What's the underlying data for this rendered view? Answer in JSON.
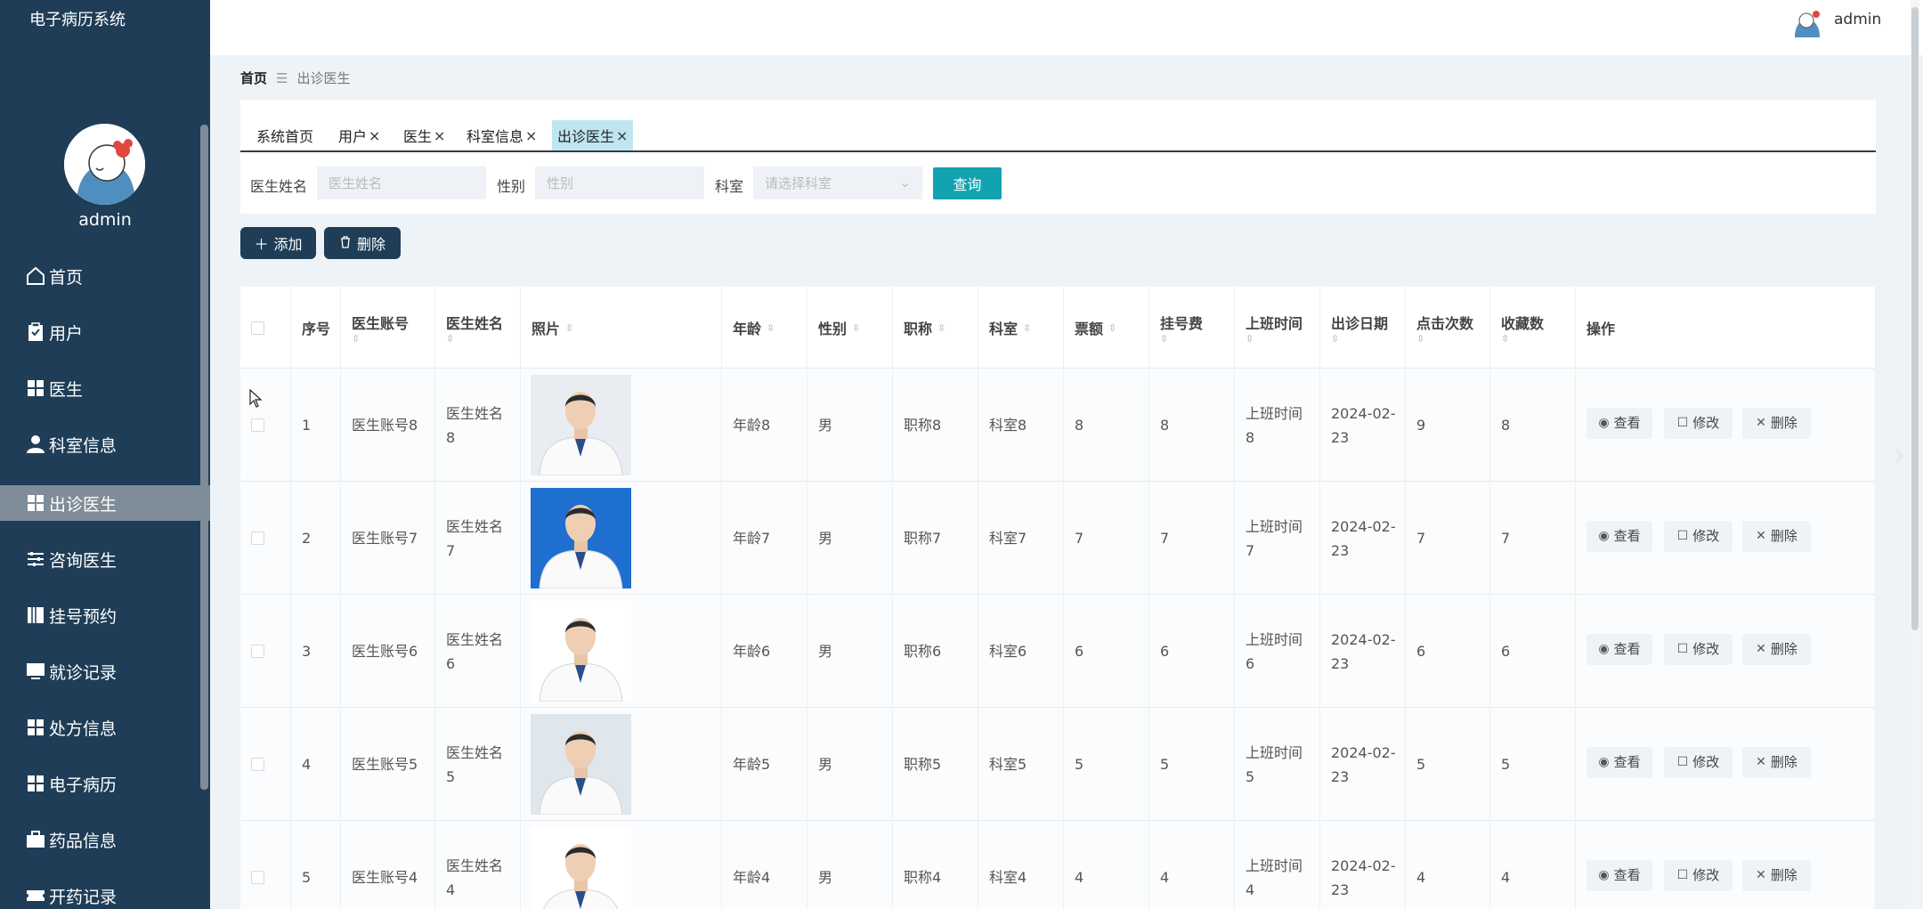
{
  "app": {
    "title": "电子病历系统",
    "user": "admin"
  },
  "sidebar": {
    "username": "admin",
    "items": [
      {
        "label": "首页",
        "icon": "home-icon"
      },
      {
        "label": "用户",
        "icon": "clipboard-icon"
      },
      {
        "label": "医生",
        "icon": "grid-icon"
      },
      {
        "label": "科室信息",
        "icon": "person-icon"
      },
      {
        "label": "出诊医生",
        "icon": "grid-icon",
        "active": true
      },
      {
        "label": "咨询医生",
        "icon": "sliders-icon"
      },
      {
        "label": "挂号预约",
        "icon": "book-icon"
      },
      {
        "label": "就诊记录",
        "icon": "monitor-icon"
      },
      {
        "label": "处方信息",
        "icon": "grid-icon"
      },
      {
        "label": "电子病历",
        "icon": "grid-icon"
      },
      {
        "label": "药品信息",
        "icon": "briefcase-icon"
      },
      {
        "label": "开药记录",
        "icon": "ticket-icon"
      }
    ]
  },
  "breadcrumb": {
    "home": "首页",
    "sep": "☰",
    "current": "出诊医生"
  },
  "tabs": [
    {
      "label": "系统首页",
      "closable": false
    },
    {
      "label": "用户",
      "closable": true
    },
    {
      "label": "医生",
      "closable": true
    },
    {
      "label": "科室信息",
      "closable": true
    },
    {
      "label": "出诊医生",
      "closable": true,
      "active": true
    }
  ],
  "tab_close_glyph": "×",
  "search": {
    "name_label": "医生姓名",
    "name_placeholder": "医生姓名",
    "gender_label": "性别",
    "gender_placeholder": "性别",
    "dept_label": "科室",
    "dept_placeholder": "请选择科室",
    "query_button": "查询"
  },
  "actions": {
    "add": "添加",
    "delete": "删除"
  },
  "table": {
    "columns": {
      "index": "序号",
      "account": "医生账号",
      "name": "医生姓名",
      "photo": "照片",
      "age": "年龄",
      "gender": "性别",
      "title": "职称",
      "dept": "科室",
      "ticket": "票额",
      "fee": "挂号费",
      "worktime": "上班时间",
      "date": "出诊日期",
      "clicks": "点击次数",
      "favs": "收藏数",
      "ops": "操作"
    },
    "sort_glyph": "⇳",
    "op_labels": {
      "view": "查看",
      "edit": "修改",
      "delete": "删除"
    },
    "rows": [
      {
        "index": "1",
        "account": "医生账号8",
        "name1": "医生姓名",
        "name2": "8",
        "age": "年龄8",
        "gender": "男",
        "title": "职称8",
        "dept": "科室8",
        "ticket": "8",
        "fee": "8",
        "work1": "上班时间",
        "work2": "8",
        "date1": "2024-02-",
        "date2": "23",
        "clicks": "9",
        "favs": "8"
      },
      {
        "index": "2",
        "account": "医生账号7",
        "name1": "医生姓名",
        "name2": "7",
        "age": "年龄7",
        "gender": "男",
        "title": "职称7",
        "dept": "科室7",
        "ticket": "7",
        "fee": "7",
        "work1": "上班时间",
        "work2": "7",
        "date1": "2024-02-",
        "date2": "23",
        "clicks": "7",
        "favs": "7"
      },
      {
        "index": "3",
        "account": "医生账号6",
        "name1": "医生姓名",
        "name2": "6",
        "age": "年龄6",
        "gender": "男",
        "title": "职称6",
        "dept": "科室6",
        "ticket": "6",
        "fee": "6",
        "work1": "上班时间",
        "work2": "6",
        "date1": "2024-02-",
        "date2": "23",
        "clicks": "6",
        "favs": "6"
      },
      {
        "index": "4",
        "account": "医生账号5",
        "name1": "医生姓名",
        "name2": "5",
        "age": "年龄5",
        "gender": "男",
        "title": "职称5",
        "dept": "科室5",
        "ticket": "5",
        "fee": "5",
        "work1": "上班时间",
        "work2": "5",
        "date1": "2024-02-",
        "date2": "23",
        "clicks": "5",
        "favs": "5"
      },
      {
        "index": "5",
        "account": "医生账号4",
        "name1": "医生姓名",
        "name2": "4",
        "age": "年龄4",
        "gender": "男",
        "title": "职称4",
        "dept": "科室4",
        "ticket": "4",
        "fee": "4",
        "work1": "上班时间",
        "work2": "4",
        "date1": "2024-02-",
        "date2": "23",
        "clicks": "4",
        "favs": "4"
      }
    ]
  },
  "colors": {
    "sidebar": "#1f3d57",
    "accent": "#13a3b0",
    "active_tab": "#bfe6ef",
    "active_menu": "#7f8d98"
  }
}
